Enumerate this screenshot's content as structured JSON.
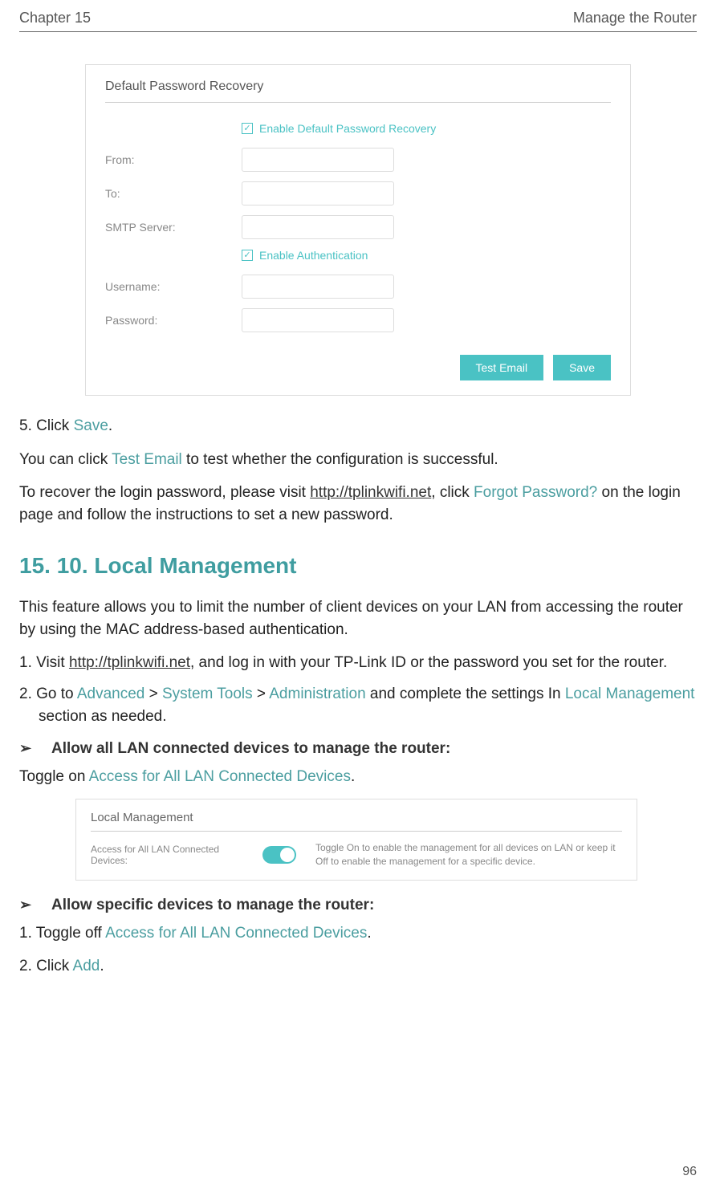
{
  "header": {
    "chapter": "Chapter 15",
    "title": "Manage the Router"
  },
  "panel1": {
    "title": "Default Password Recovery",
    "check1": "Enable Default Password Recovery",
    "labels": {
      "from": "From:",
      "to": "To:",
      "smtp": "SMTP Server:",
      "username": "Username:",
      "password": "Password:"
    },
    "check2": "Enable Authentication",
    "buttons": {
      "test": "Test Email",
      "save": "Save"
    }
  },
  "body": {
    "step5_prefix": "5. Click ",
    "step5_action": "Save",
    "step5_suffix": ".",
    "line2_a": "You can click ",
    "line2_b": "Test Email",
    "line2_c": " to test whether the configuration is successful.",
    "line3_a": "To recover the login password, please visit ",
    "line3_link": "http://tplinkwifi.net",
    "line3_b": ", click ",
    "line3_c": "Forgot Password?",
    "line3_d": " on the login page and follow the instructions to set a new password."
  },
  "section": {
    "heading": "15. 10.  Local Management",
    "intro": "This feature allows you to limit the number of client devices on your LAN from accessing the router by using the MAC address-based authentication.",
    "step1_a": "1. Visit ",
    "step1_link": "http://tplinkwifi.net",
    "step1_b": ", and log in with your TP-Link ID or the password you set for the router.",
    "step2_a": "2. Go to ",
    "step2_b": "Advanced",
    "step2_c": " > ",
    "step2_d": "System Tools",
    "step2_e": " > ",
    "step2_f": "Administration",
    "step2_g": " and complete the settings In ",
    "step2_h": "Local Management",
    "step2_i": " section as needed.",
    "bullet1": "Allow all LAN connected devices to manage the router:",
    "toggle_a": "Toggle on ",
    "toggle_b": "Access for All LAN Connected Devices",
    "toggle_c": ".",
    "bullet2": "Allow specific devices to manage the router:",
    "off_a": "1. Toggle off ",
    "off_b": "Access for All LAN Connected Devices",
    "off_c": ".",
    "add_a": "2. Click ",
    "add_b": "Add",
    "add_c": "."
  },
  "panel2": {
    "title": "Local Management",
    "label": "Access for All LAN Connected Devices:",
    "desc": "Toggle On to enable the management for all devices on LAN or keep it Off to enable the management for a specific device."
  },
  "page_number": "96"
}
